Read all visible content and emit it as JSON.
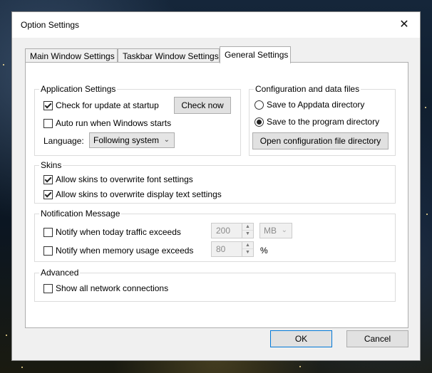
{
  "window": {
    "title": "Option Settings",
    "close_symbol": "✕"
  },
  "tabs": [
    {
      "label": "Main Window Settings",
      "active": false
    },
    {
      "label": "Taskbar Window Settings",
      "active": false
    },
    {
      "label": "General Settings",
      "active": true
    }
  ],
  "application_settings": {
    "label": "Application Settings",
    "check_update": {
      "label": "Check for update at startup",
      "checked": true
    },
    "check_now_label": "Check now",
    "auto_run": {
      "label": "Auto run when Windows starts",
      "checked": false
    },
    "language_label": "Language:",
    "language_value": "Following system"
  },
  "config_files": {
    "label": "Configuration and data files",
    "appdata": {
      "label": "Save to Appdata directory",
      "selected": false
    },
    "program_dir": {
      "label": "Save to the program directory",
      "selected": true
    },
    "open_dir_label": "Open configuration file directory"
  },
  "skins": {
    "label": "Skins",
    "font": {
      "label": "Allow skins to overwrite font settings",
      "checked": true
    },
    "display_text": {
      "label": "Allow skins to overwrite display text settings",
      "checked": true
    }
  },
  "notification": {
    "label": "Notification Message",
    "traffic": {
      "label": "Notify when today traffic exceeds",
      "checked": false,
      "value": "200",
      "unit": "MB"
    },
    "memory": {
      "label": "Notify when memory usage exceeds",
      "checked": false,
      "value": "80",
      "unit": "%"
    }
  },
  "advanced": {
    "label": "Advanced",
    "show_all": {
      "label": "Show all network connections",
      "checked": false
    }
  },
  "footer": {
    "ok_label": "OK",
    "cancel_label": "Cancel"
  }
}
